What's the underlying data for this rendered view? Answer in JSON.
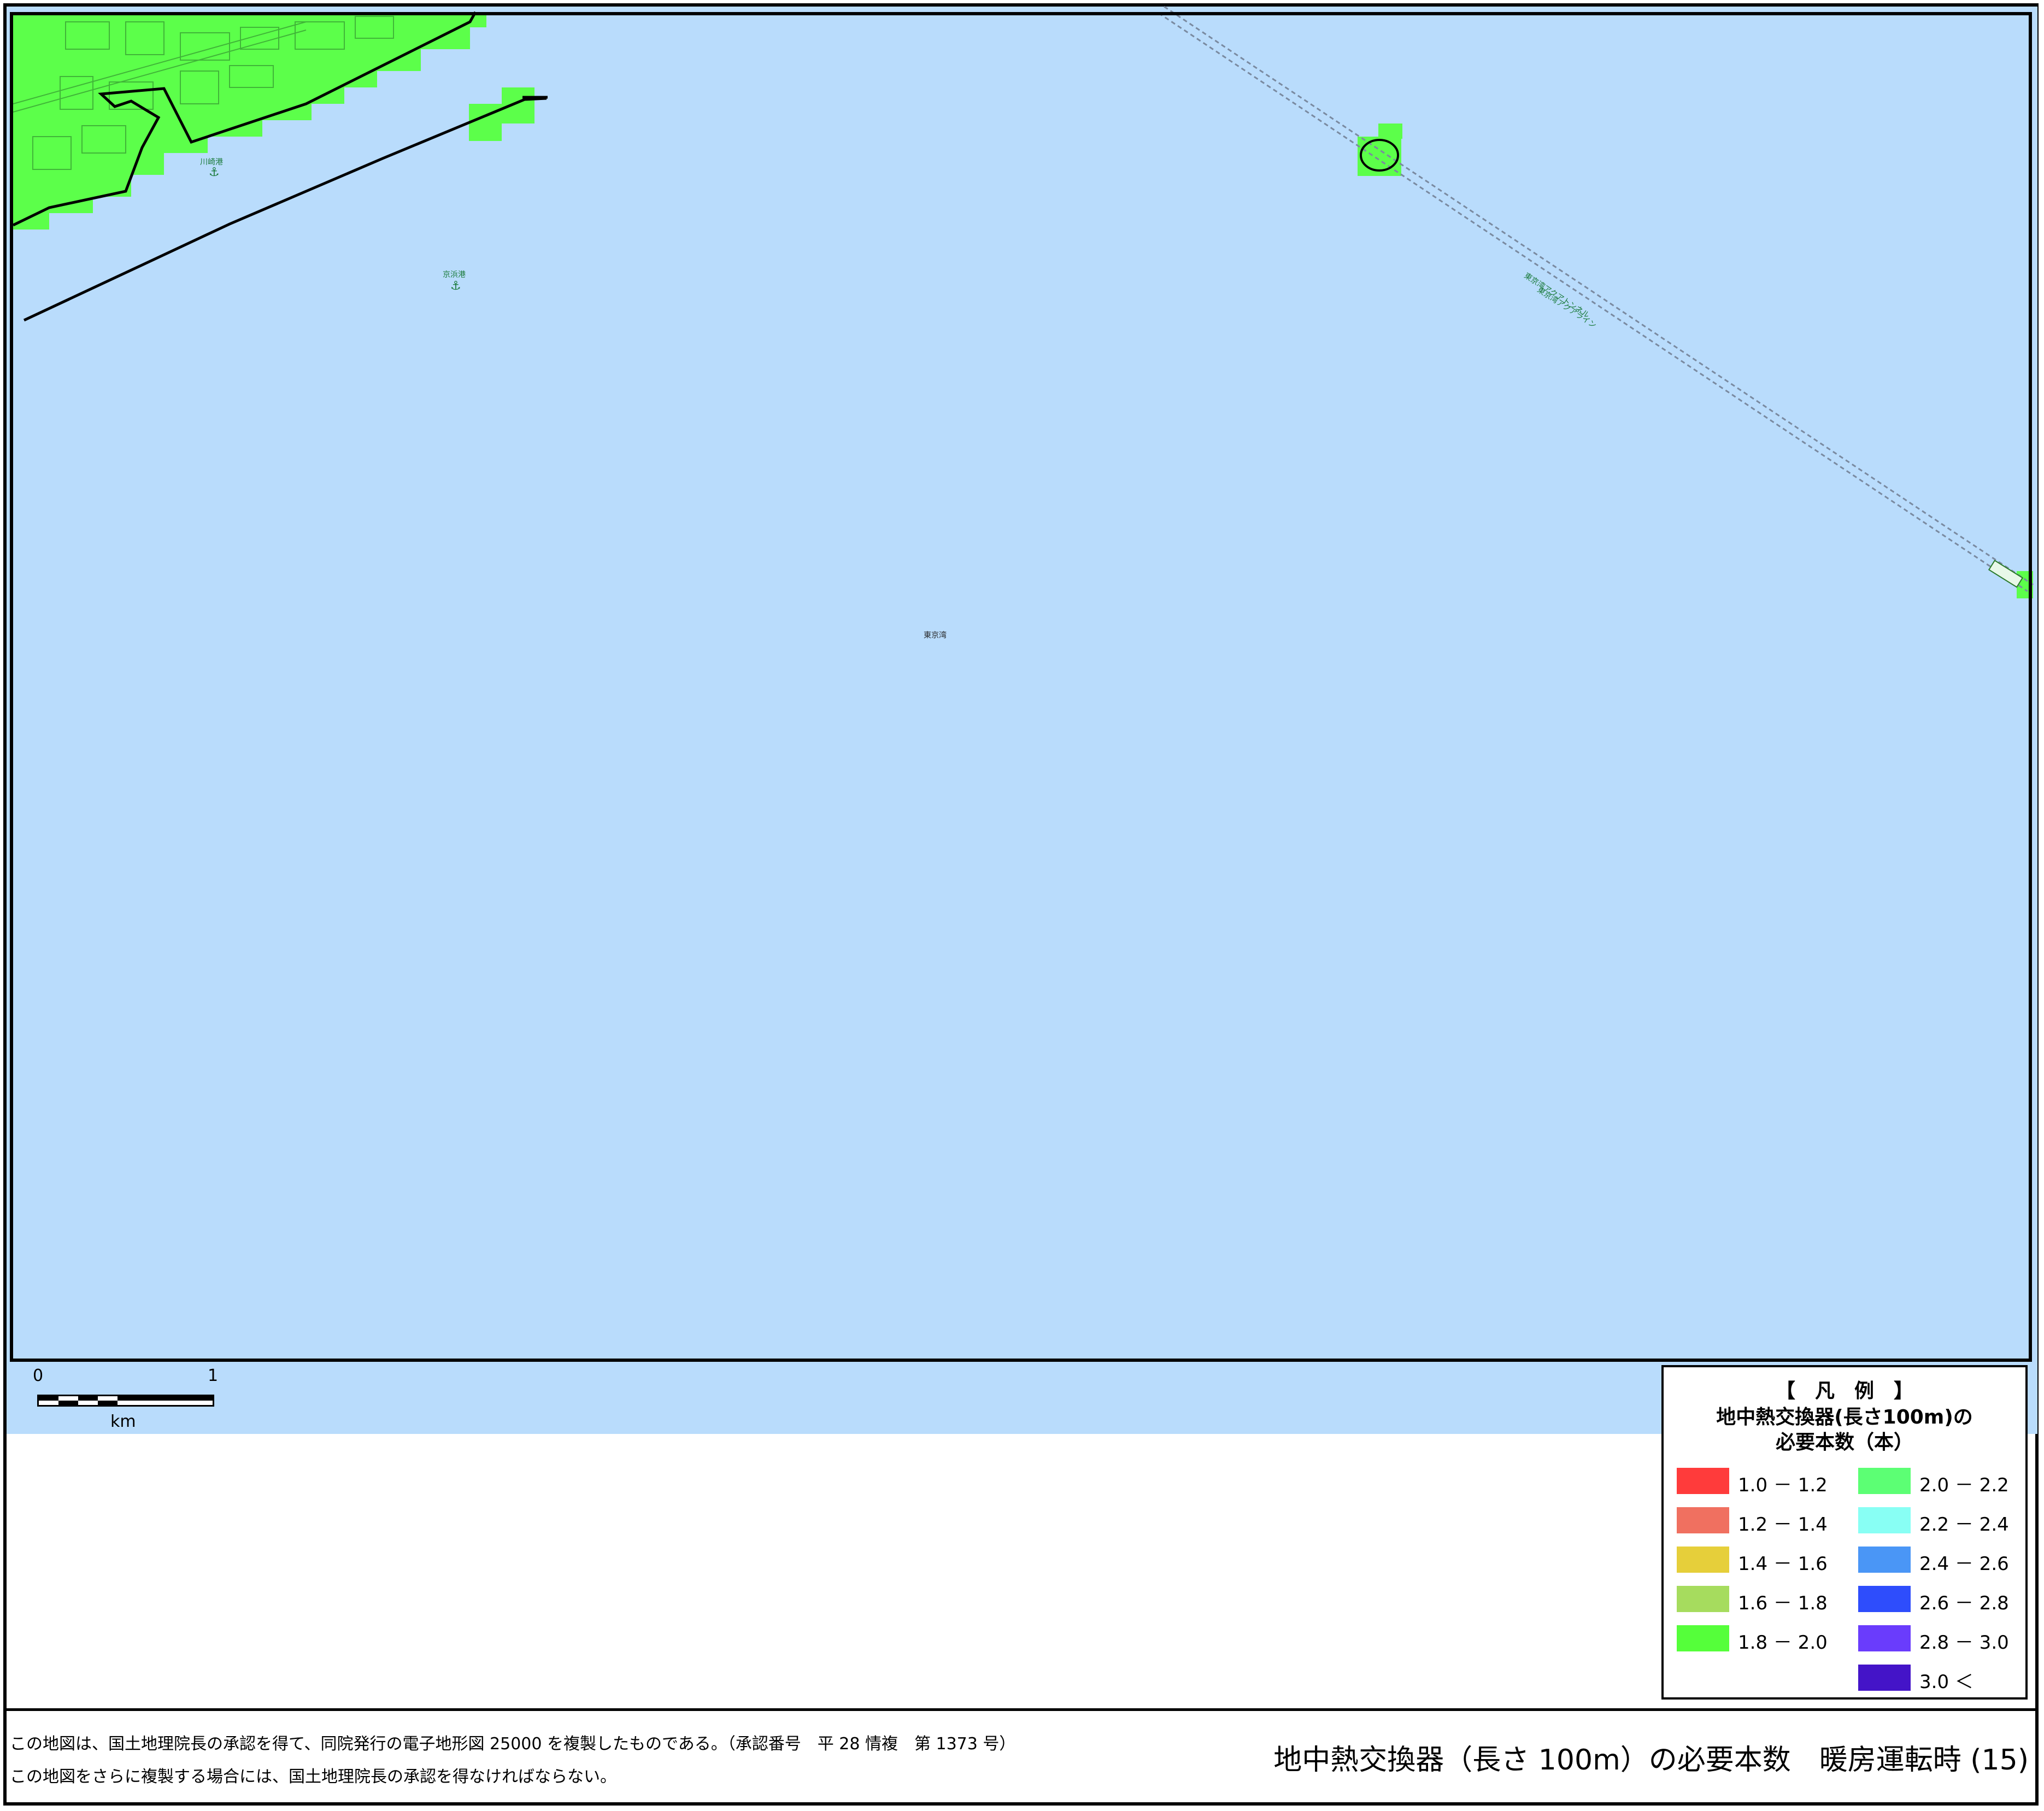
{
  "map": {
    "place_labels": {
      "kawasaki_port": "川崎港",
      "keihin_port": "京浜港",
      "tokyo_bay": "東京湾",
      "aqualine_1": "東京湾アクアライン",
      "aqualine_2": "東京湾アクアトンネル"
    },
    "colors": {
      "water": "#b9dcfc",
      "land_green": "#5cff4a",
      "route_line": "#7a8aa0",
      "frame": "#000000"
    }
  },
  "scalebar": {
    "label_start": "0",
    "label_end": "1",
    "unit": "km"
  },
  "legend": {
    "heading": "【　凡　例　】",
    "title_line1": "地中熱交換器(長さ100m)の",
    "title_line2": "必要本数（本）",
    "items": [
      {
        "label": "1.0 － 1.2",
        "color": "#ff3b3b"
      },
      {
        "label": "1.2 － 1.4",
        "color": "#f07060"
      },
      {
        "label": "1.4 － 1.6",
        "color": "#e6cf3a"
      },
      {
        "label": "1.6 － 1.8",
        "color": "#a6dc5e"
      },
      {
        "label": "1.8 － 2.0",
        "color": "#55ff3a"
      },
      {
        "label": "2.0 － 2.2",
        "color": "#5cff74"
      },
      {
        "label": "2.2 － 2.4",
        "color": "#88fff4"
      },
      {
        "label": "2.4 － 2.6",
        "color": "#4a96f6"
      },
      {
        "label": "2.6 － 2.8",
        "color": "#2e4dfc"
      },
      {
        "label": "2.8 － 3.0",
        "color": "#6a3cfc"
      },
      {
        "label": "3.0 ＜",
        "color": "#4414c8"
      }
    ]
  },
  "footer": {
    "note_line1": "この地図は、国土地理院長の承認を得て、同院発行の電子地形図 25000 を複製したものである。（承認番号　平 28 情複　第 1373 号）",
    "note_line2": "この地図をさらに複製する場合には、国土地理院長の承認を得なければならない。",
    "title": "地中熱交換器（長さ 100m）の必要本数　暖房運転時 (15)"
  }
}
